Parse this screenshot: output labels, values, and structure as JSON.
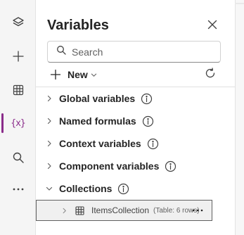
{
  "rail": {
    "items": [
      {
        "icon": "layers-icon"
      },
      {
        "icon": "plus-icon"
      },
      {
        "icon": "grid-icon"
      },
      {
        "icon": "variables-icon",
        "glyph": "{x}",
        "active": true
      },
      {
        "icon": "search-icon"
      },
      {
        "icon": "more-icon"
      }
    ]
  },
  "panel": {
    "title": "Variables",
    "search_placeholder": "Search",
    "new_label": "New",
    "sections": [
      {
        "label": "Global variables",
        "expanded": false
      },
      {
        "label": "Named formulas",
        "expanded": false
      },
      {
        "label": "Context variables",
        "expanded": false
      },
      {
        "label": "Component variables",
        "expanded": false
      },
      {
        "label": "Collections",
        "expanded": true
      }
    ],
    "collection_item": {
      "name": "ItemsCollection",
      "meta": "(Table: 6 rows)"
    }
  },
  "colors": {
    "accent": "#8a2c8a",
    "rail_bg": "#f5f5f5",
    "selected_row_bg": "#f0f0f0",
    "selected_row_border": "#616161"
  }
}
